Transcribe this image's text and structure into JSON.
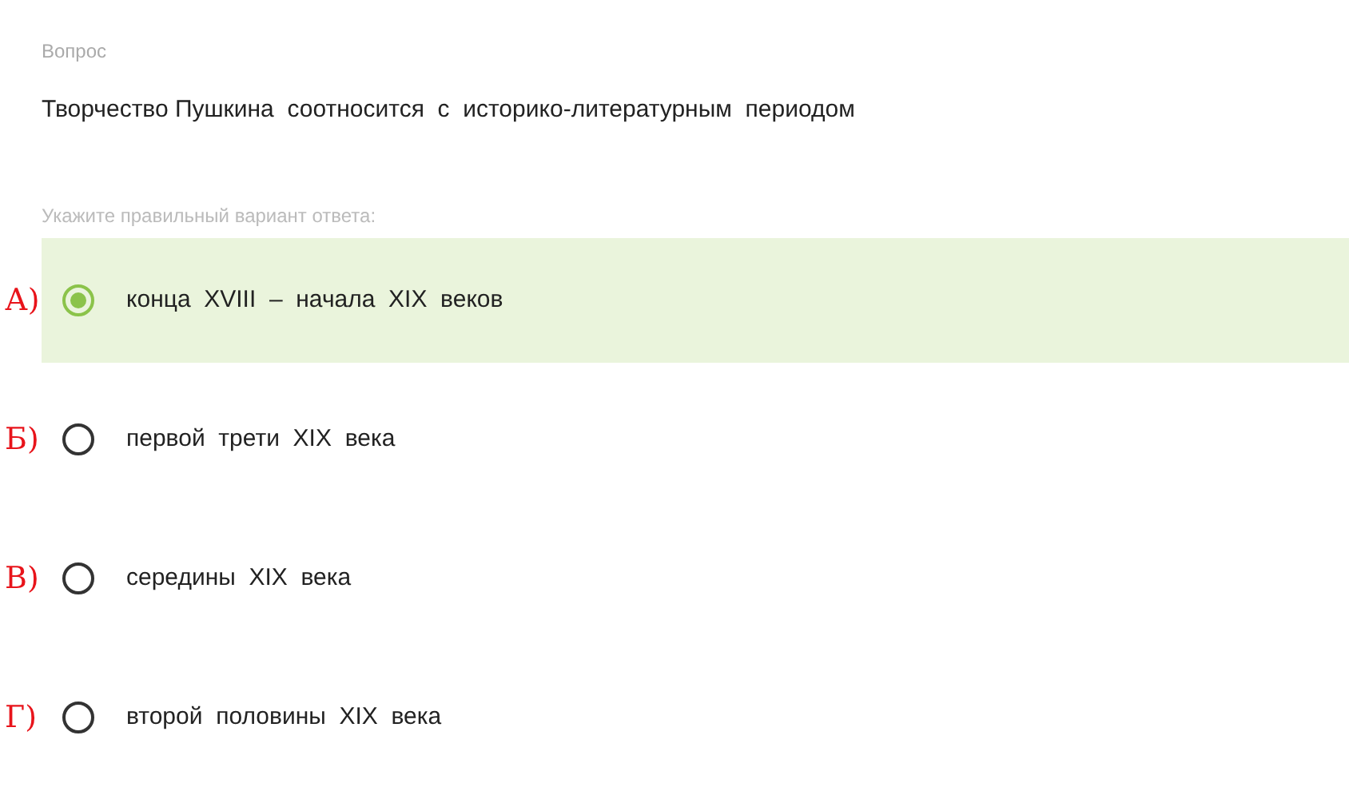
{
  "section_label": "Вопрос",
  "question": "Творчество Пушкина  соотносится  с  историко-литературным  периодом",
  "instruction": "Укажите правильный вариант ответа:",
  "options": [
    {
      "label": "конца  XVIII  –  начала  XIX  веков",
      "selected": true,
      "handwritten_mark": "А)"
    },
    {
      "label": "первой  трети  XIX  века",
      "selected": false,
      "handwritten_mark": "Б)"
    },
    {
      "label": "середины  XIX  века",
      "selected": false,
      "handwritten_mark": "В)"
    },
    {
      "label": "второй  половины  XIX  века",
      "selected": false,
      "handwritten_mark": "Г)"
    }
  ]
}
